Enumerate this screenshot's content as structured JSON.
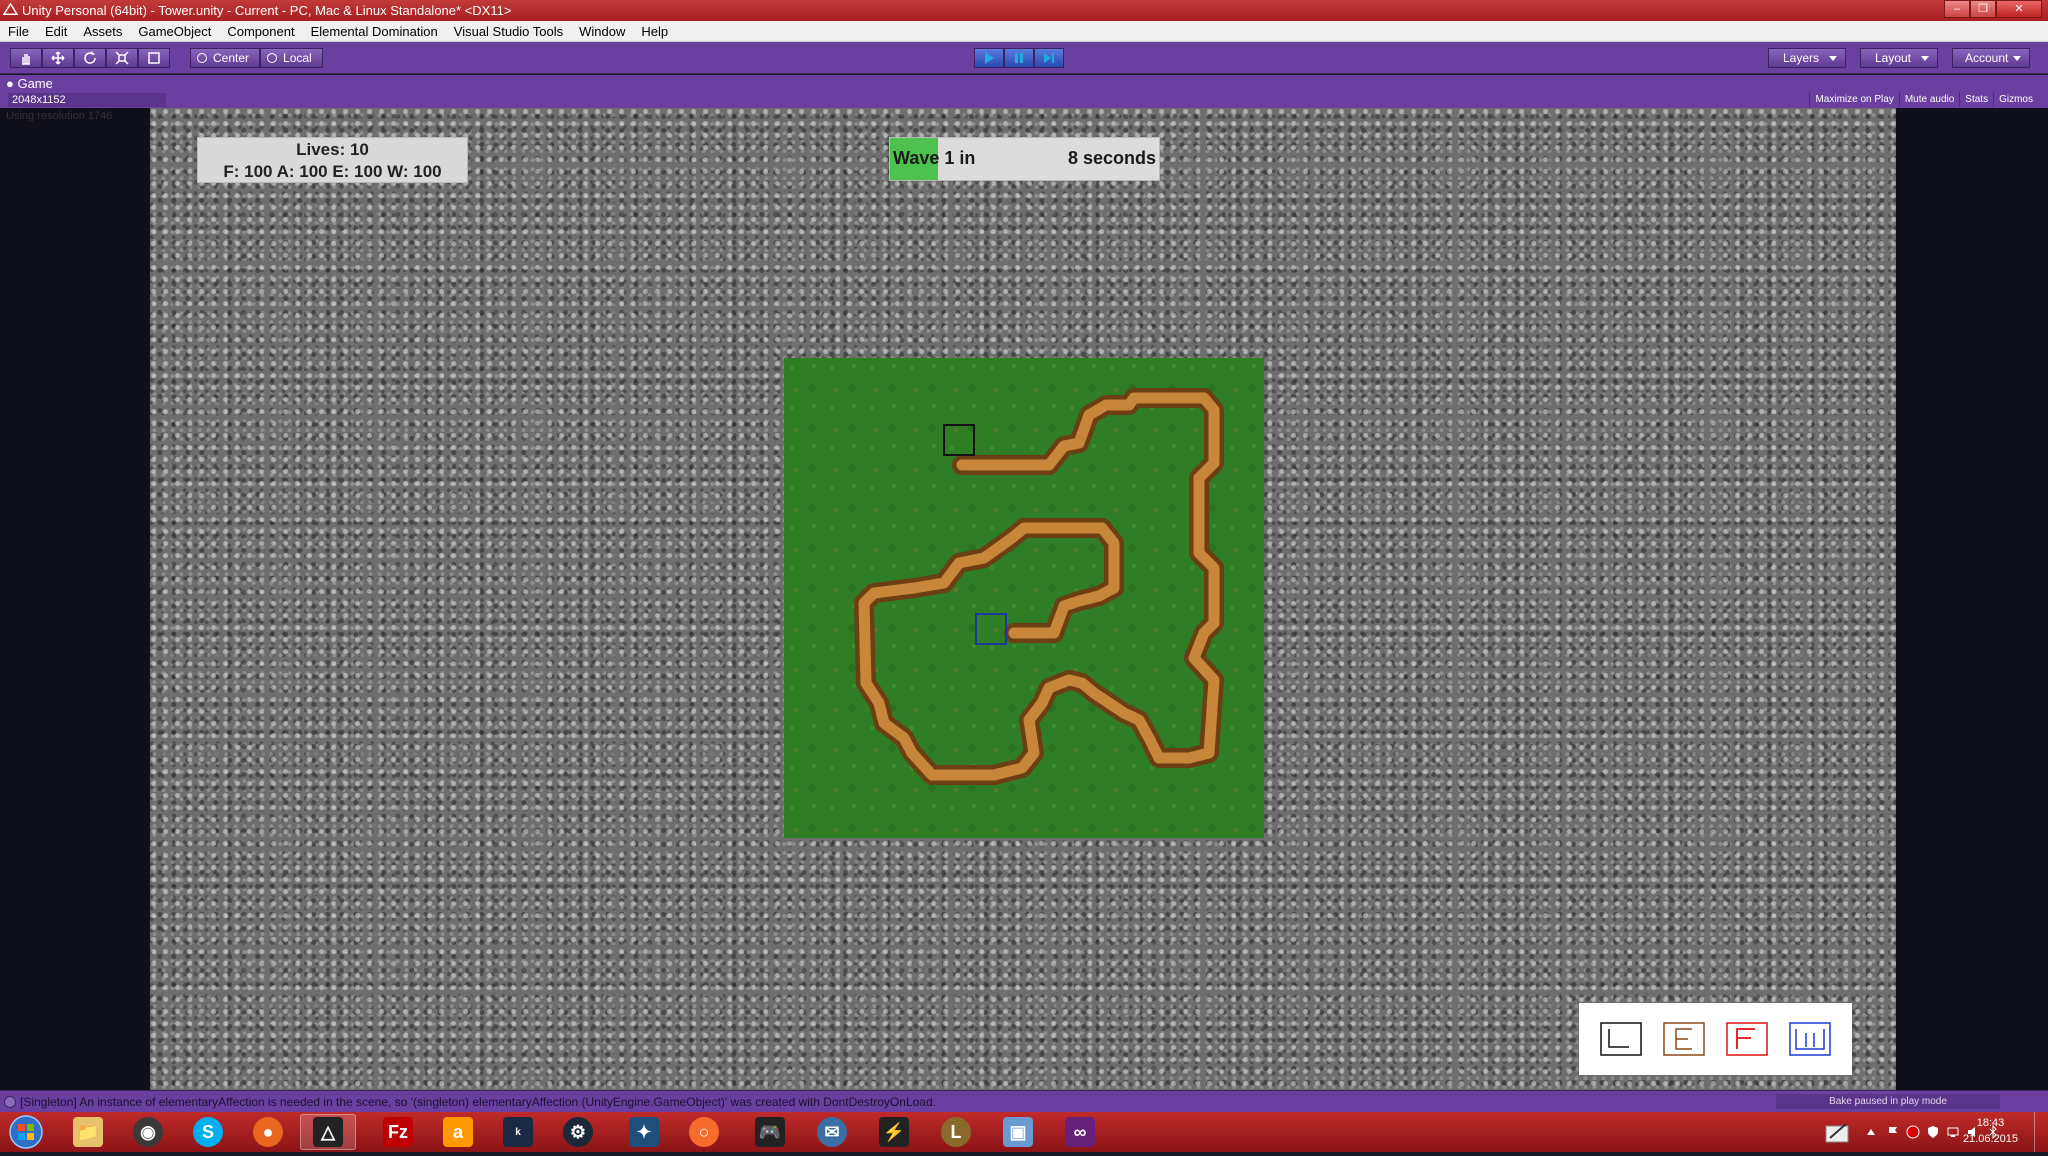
{
  "window": {
    "title": "Unity Personal (64bit) - Tower.unity - Current - PC, Mac & Linux Standalone* <DX11>",
    "controls": [
      "minimize-icon",
      "restore-icon",
      "close-icon"
    ]
  },
  "menu": [
    "File",
    "Edit",
    "Assets",
    "GameObject",
    "Component",
    "Elemental Domination",
    "Visual Studio Tools",
    "Window",
    "Help"
  ],
  "toolbar": {
    "transform_tools": [
      "hand-icon",
      "move-icon",
      "rotate-icon",
      "scale-icon",
      "rect-icon"
    ],
    "pivot_label": "Center",
    "space_label": "Local",
    "play_controls": [
      "play-icon",
      "pause-icon",
      "step-icon"
    ],
    "layers_label": "Layers",
    "layout_label": "Layout",
    "account_label": "Account",
    "accent_color": "#6a3fa0",
    "play_active_color": "#2a4ab0"
  },
  "game_panel": {
    "tab_label": "Game",
    "resolution": "2048x1152",
    "using_resolution": "Using resolution 1746",
    "options": [
      "Maximize on Play",
      "Mute audio",
      "Stats",
      "Gizmos"
    ]
  },
  "hud": {
    "lives_line": "Lives: 10",
    "resources_line": "F: 100 A: 100 E: 100 W: 100",
    "wave_label": "Wave 1 in",
    "wave_time": "8 seconds",
    "wave_progress": 0.18,
    "wave_fill_color": "#4ec24e"
  },
  "map": {
    "grass_color": "#2f7d25",
    "path_color": "#b0702a",
    "markers": [
      {
        "name": "spawn-marker",
        "color": "#111111"
      },
      {
        "name": "base-marker",
        "color": "#1a3aa0"
      }
    ]
  },
  "tower_panel": {
    "towers": [
      {
        "name": "tower-option-earth",
        "color": "#111111"
      },
      {
        "name": "tower-option-air",
        "color": "#8a4a1a"
      },
      {
        "name": "tower-option-fire",
        "color": "#e01010"
      },
      {
        "name": "tower-option-water",
        "color": "#1a3ad0"
      }
    ]
  },
  "status": {
    "message": "[Singleton] An instance of elementaryAffection is needed in the scene, so '(singleton) elementaryAffection (UnityEngine.GameObject)' was created with DontDestroyOnLoad.",
    "right": "Bake paused in play mode"
  },
  "taskbar": {
    "apps": [
      "explorer-icon",
      "media-icon",
      "skype-icon",
      "firefox-icon",
      "unity-icon",
      "filezilla-icon",
      "amazon-icon",
      "kindle-icon",
      "steam-icon",
      "game-icon",
      "origin-icon",
      "gamepad-icon",
      "thunderbird-icon",
      "winamp-icon",
      "league-icon",
      "remote-desktop-icon",
      "visual-studio-icon"
    ],
    "active_app": "unity-icon",
    "time": "18:43",
    "date": "21.06.2015"
  }
}
